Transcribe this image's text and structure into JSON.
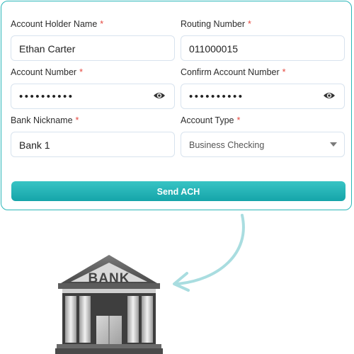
{
  "form": {
    "account_holder_label": "Account Holder Name",
    "account_holder_value": "Ethan Carter",
    "routing_label": "Routing Number",
    "routing_value": "011000015",
    "account_number_label": "Account Number",
    "account_number_value": "••••••••••",
    "confirm_account_label": "Confirm Account Number",
    "confirm_account_value": "••••••••••",
    "nickname_label": "Bank Nickname",
    "nickname_value": "Bank 1",
    "account_type_label": "Account Type",
    "account_type_value": "Business Checking",
    "required_marker": "*",
    "submit_label": "Send ACH"
  },
  "illustration": {
    "bank_sign": "BANK",
    "icon": "bank-building-icon",
    "arrow_icon": "curved-arrow-icon"
  },
  "colors": {
    "accent": "#1aaeb0",
    "required": "#e5483f",
    "field_border": "#d8e3ee"
  }
}
